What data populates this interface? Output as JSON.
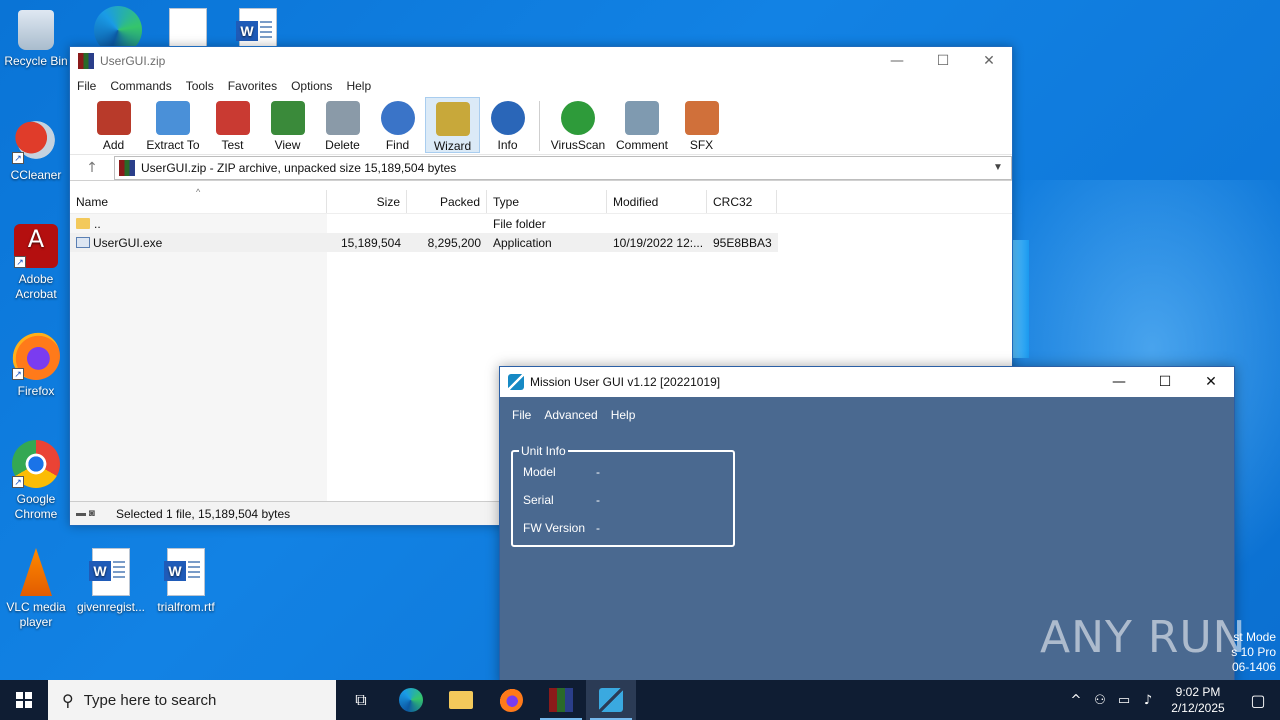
{
  "desktop": {
    "icons": [
      {
        "label": "Recycle Bin"
      },
      {
        "label": "CCleaner"
      },
      {
        "label": "Adobe Acrobat"
      },
      {
        "label": "Firefox"
      },
      {
        "label": "Google Chrome"
      },
      {
        "label": "VLC media player"
      },
      {
        "label": "givenregist..."
      },
      {
        "label": "trialfrom.rtf"
      }
    ],
    "watermark": "ANY RUN",
    "test_mode_lines": [
      "st Mode",
      "s 10 Pro",
      "06-1406"
    ]
  },
  "winrar": {
    "title": "UserGUI.zip",
    "menu": [
      "File",
      "Commands",
      "Tools",
      "Favorites",
      "Options",
      "Help"
    ],
    "toolbar": [
      {
        "label": "Add",
        "color": "#b83a2a"
      },
      {
        "label": "Extract To",
        "color": "#4a90d8"
      },
      {
        "label": "Test",
        "color": "#c93a32"
      },
      {
        "label": "View",
        "color": "#3a8a3a"
      },
      {
        "label": "Delete",
        "color": "#8a9aa8"
      },
      {
        "label": "Find",
        "color": "#3a74c8"
      },
      {
        "label": "Wizard",
        "color": "#c8a83a"
      },
      {
        "label": "Info",
        "color": "#2a66b8"
      },
      {
        "label": "VirusScan",
        "color": "#2e9b3a"
      },
      {
        "label": "Comment",
        "color": "#7f9ab0"
      },
      {
        "label": "SFX",
        "color": "#d0703a"
      }
    ],
    "address": "UserGUI.zip - ZIP archive, unpacked size 15,189,504 bytes",
    "columns": {
      "name": "Name",
      "size": "Size",
      "packed": "Packed",
      "type": "Type",
      "modified": "Modified",
      "crc": "CRC32"
    },
    "rows": [
      {
        "name": "..",
        "size": "",
        "packed": "",
        "type": "File folder",
        "modified": "",
        "crc": ""
      },
      {
        "name": "UserGUI.exe",
        "size": "15,189,504",
        "packed": "8,295,200",
        "type": "Application",
        "modified": "10/19/2022 12:...",
        "crc": "95E8BBA3"
      }
    ],
    "status": "Selected 1 file, 15,189,504 bytes"
  },
  "mission": {
    "title": "Mission User GUI v1.12 [20221019]",
    "menu": [
      "File",
      "Advanced",
      "Help"
    ],
    "unit_info": {
      "legend": "Unit Info",
      "rows": [
        {
          "key": "Model",
          "value": "-"
        },
        {
          "key": "Serial",
          "value": "-"
        },
        {
          "key": "FW Version",
          "value": "-"
        }
      ]
    }
  },
  "taskbar": {
    "search_placeholder": "Type here to search",
    "time": "9:02 PM",
    "date": "2/12/2025"
  }
}
